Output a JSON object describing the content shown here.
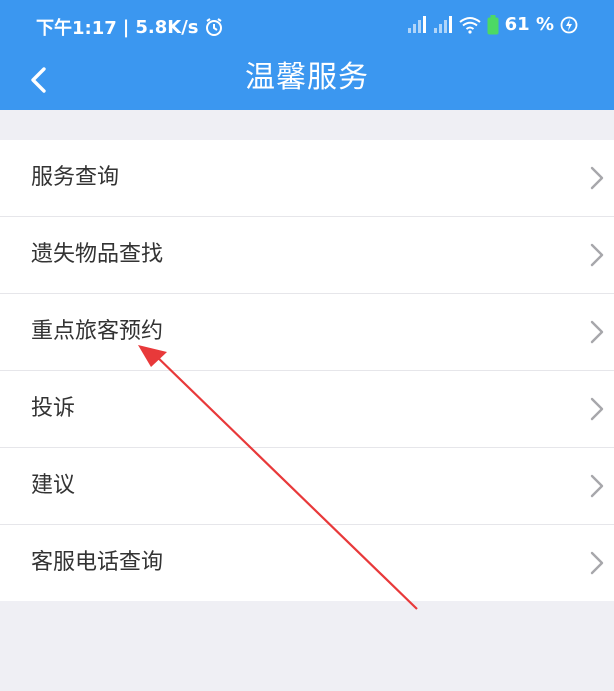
{
  "status_bar": {
    "time": "下午1:17",
    "separator": "|",
    "speed": "5.8K/s",
    "battery": "61 %"
  },
  "header": {
    "title": "温馨服务"
  },
  "menu": {
    "items": [
      {
        "label": "服务查询"
      },
      {
        "label": "遗失物品查找"
      },
      {
        "label": "重点旅客预约"
      },
      {
        "label": "投诉"
      },
      {
        "label": "建议"
      },
      {
        "label": "客服电话查询"
      }
    ]
  },
  "colors": {
    "header_bg": "#3b97f0",
    "page_bg": "#efeff4",
    "annotation_arrow": "#e8393a"
  }
}
